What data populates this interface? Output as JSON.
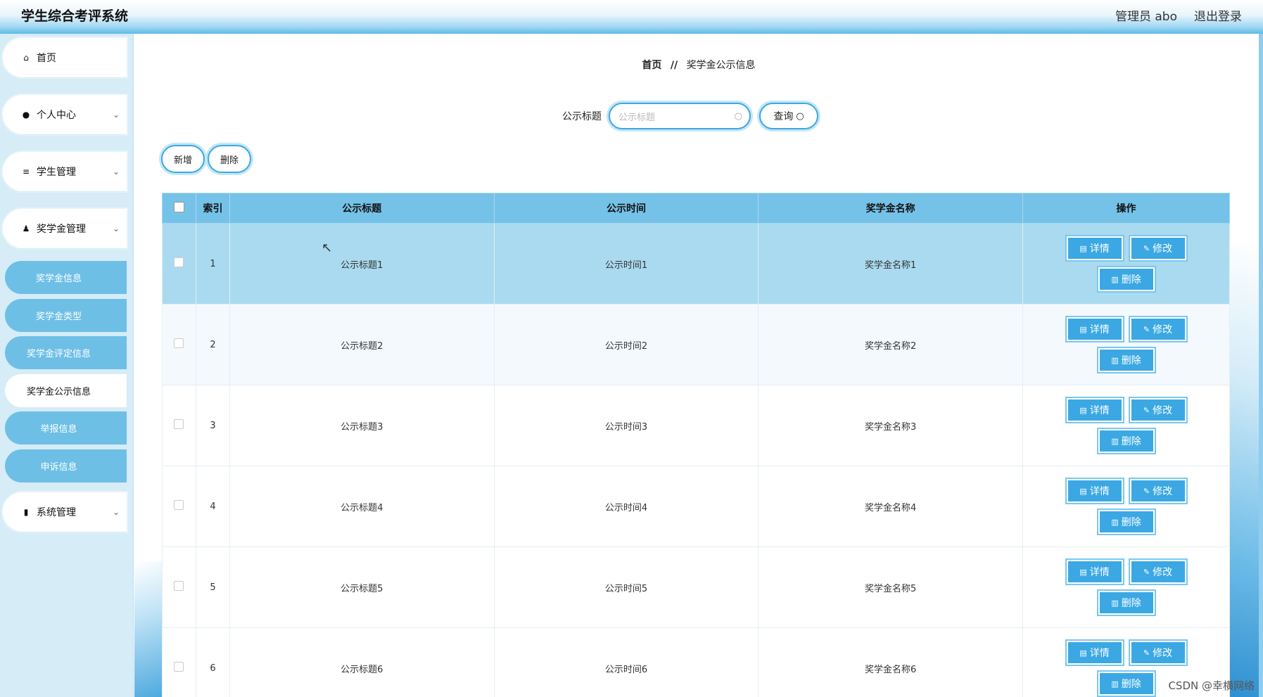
{
  "app": {
    "title": "学生综合考评系统",
    "user": "管理员 abo",
    "logout": "退出登录"
  },
  "sidebar": {
    "items": [
      {
        "label": "首页",
        "icon": "home-icon",
        "glyph": "⌂"
      },
      {
        "label": "个人中心",
        "icon": "user-icon",
        "glyph": "●"
      },
      {
        "label": "学生管理",
        "icon": "list-icon",
        "glyph": "≡"
      },
      {
        "label": "奖学金管理",
        "icon": "person-icon",
        "glyph": "♟"
      },
      {
        "label": "系统管理",
        "icon": "book-icon",
        "glyph": "▮"
      }
    ],
    "subitems": [
      {
        "label": "奖学金信息"
      },
      {
        "label": "奖学金类型"
      },
      {
        "label": "奖学金评定信息"
      },
      {
        "label": "奖学金公示信息"
      },
      {
        "label": "举报信息"
      },
      {
        "label": "申诉信息"
      }
    ]
  },
  "breadcrumb": {
    "home": "首页",
    "sep": "//",
    "current": "奖学金公示信息"
  },
  "search": {
    "label": "公示标题",
    "placeholder": "公示标题",
    "button": "查询"
  },
  "actions": {
    "add": "新增",
    "delete": "删除"
  },
  "table": {
    "headers": [
      "索引",
      "公示标题",
      "公示时间",
      "奖学金名称",
      "操作"
    ],
    "rows": [
      {
        "index": "1",
        "title": "公示标题1",
        "time": "公示时间1",
        "name": "奖学金名称1"
      },
      {
        "index": "2",
        "title": "公示标题2",
        "time": "公示时间2",
        "name": "奖学金名称2"
      },
      {
        "index": "3",
        "title": "公示标题3",
        "time": "公示时间3",
        "name": "奖学金名称3"
      },
      {
        "index": "4",
        "title": "公示标题4",
        "time": "公示时间4",
        "name": "奖学金名称4"
      },
      {
        "index": "5",
        "title": "公示标题5",
        "time": "公示时间5",
        "name": "奖学金名称5"
      },
      {
        "index": "6",
        "title": "公示标题6",
        "time": "公示时间6",
        "name": "奖学金名称6"
      }
    ],
    "row_buttons": {
      "detail": "详情",
      "edit": "修改",
      "delete": "删除"
    }
  },
  "watermark": "CSDN @幸横网络",
  "colors": {
    "accent": "#3ba8e3",
    "header_bg": "#75c2e8",
    "sidebar_bg": "#d6ecf7",
    "submenu_bg": "#6ebfe6"
  }
}
